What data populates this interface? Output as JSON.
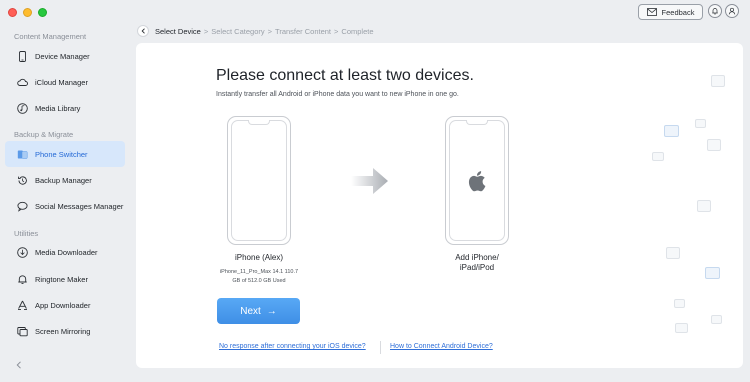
{
  "sidebar": {
    "sections": [
      {
        "title": "Content Management"
      },
      {
        "title": "Backup & Migrate"
      },
      {
        "title": "Utilities"
      }
    ],
    "items": [
      {
        "label": "Device Manager",
        "icon": "phone-icon"
      },
      {
        "label": "iCloud Manager",
        "icon": "cloud-icon"
      },
      {
        "label": "Media Library",
        "icon": "music-icon"
      },
      {
        "label": "Phone Switcher",
        "icon": "phone-switch-icon",
        "active": true
      },
      {
        "label": "Backup Manager",
        "icon": "history-icon"
      },
      {
        "label": "Social Messages Manager",
        "icon": "chat-icon"
      },
      {
        "label": "Media Downloader",
        "icon": "download-icon"
      },
      {
        "label": "Ringtone Maker",
        "icon": "bell-icon"
      },
      {
        "label": "App Downloader",
        "icon": "app-store-icon"
      },
      {
        "label": "Screen Mirroring",
        "icon": "mirror-icon"
      }
    ],
    "collapse_icon": "chevron-left-icon"
  },
  "topbar": {
    "feedback_label": "Feedback",
    "feedback_icon": "mail-icon",
    "notification_icon": "bell-icon",
    "account_icon": "user-icon"
  },
  "breadcrumb": {
    "back_icon": "chevron-left-icon",
    "steps": [
      {
        "label": "Select Device",
        "current": true
      },
      {
        "label": "Select Category"
      },
      {
        "label": "Transfer Content"
      },
      {
        "label": "Complete"
      }
    ],
    "separator": ">"
  },
  "main": {
    "title": "Please connect at least two devices.",
    "subtitle": "Instantly transfer all Android or iPhone data you want to new iPhone in one go.",
    "source_device": {
      "name": "iPhone (Alex)",
      "model_line": "iPhone_11_Pro_Max 14.1 110.7",
      "storage_line": "GB of  512.0 GB Used"
    },
    "target_device": {
      "name": "Add iPhone/\niPad/iPod",
      "icon": "apple-logo-icon"
    },
    "next_label": "Next",
    "next_arrow": "→",
    "links": {
      "ios": "No response after connecting your iOS device?",
      "android": "How to Connect Android Device?"
    }
  },
  "colors": {
    "accent": "#3f8fe6",
    "active_bg": "#d7e7fb",
    "link": "#2f6fd8"
  }
}
